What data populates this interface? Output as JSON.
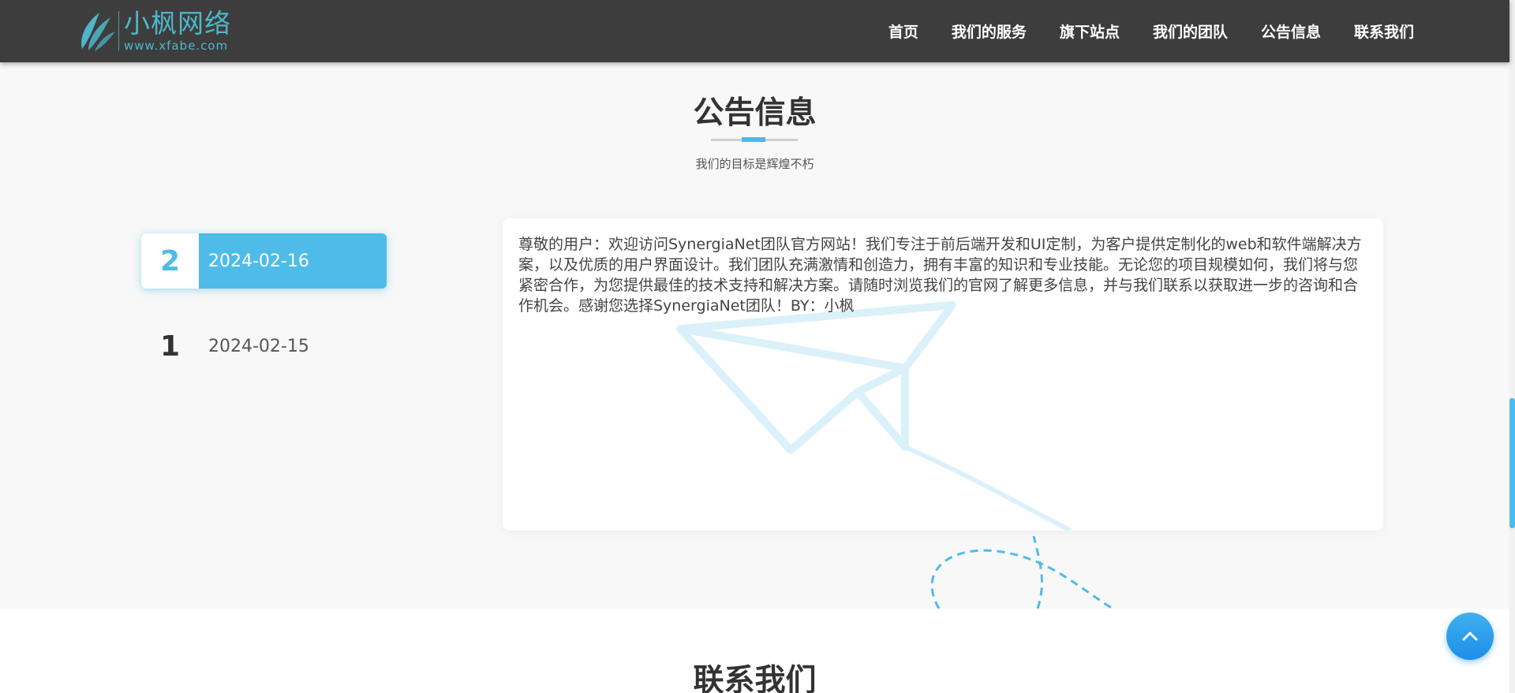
{
  "header": {
    "logo_name": "小枫网络",
    "logo_url": "www.xfabe.com",
    "nav": [
      {
        "label": "首页"
      },
      {
        "label": "我们的服务"
      },
      {
        "label": "旗下站点"
      },
      {
        "label": "我们的团队"
      },
      {
        "label": "公告信息"
      },
      {
        "label": "联系我们"
      }
    ]
  },
  "notice_section": {
    "title": "公告信息",
    "subtitle": "我们的目标是辉煌不朽",
    "items": [
      {
        "num": "2",
        "date": "2024-02-16",
        "active": true
      },
      {
        "num": "1",
        "date": "2024-02-15",
        "active": false
      }
    ],
    "content": "尊敬的用户：欢迎访问SynergiaNet团队官方网站！我们专注于前后端开发和UI定制，为客户提供定制化的web和软件端解决方案，以及优质的用户界面设计。我们团队充满激情和创造力，拥有丰富的知识和专业技能。无论您的项目规模如何，我们将与您紧密合作，为您提供最佳的技术支持和解决方案。请随时浏览我们的官网了解更多信息，并与我们联系以获取进一步的咨询和合作机会。感谢您选择SynergiaNet团队！BY：小枫"
  },
  "contact_section": {
    "title": "联系我们"
  },
  "colors": {
    "header_bg": "#3d3d3d",
    "brand": "#4fb6c9",
    "accent": "#4fbbe8",
    "back_top": "#1e8ee8"
  },
  "icons": {
    "logo": "leaf-logo-icon",
    "plane": "paper-plane-icon",
    "back_top": "chevron-up-icon"
  }
}
